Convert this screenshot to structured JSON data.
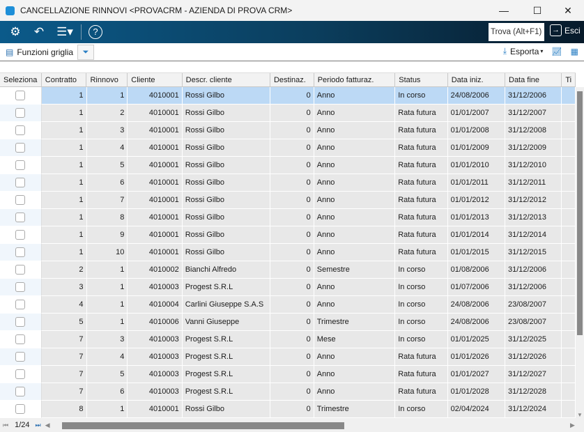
{
  "window": {
    "title": "CANCELLAZIONE RINNOVI <PROVACRM - AZIENDA DI PROVA CRM>",
    "minimize": "—",
    "maximize": "☐",
    "close": "✕"
  },
  "toolbar": {
    "find_label": "Trova (Alt+F1)",
    "exit_label": "Esci"
  },
  "gridbar": {
    "functions_label": "Funzioni griglia",
    "export_label": "Esporta"
  },
  "columns": [
    "Seleziona",
    "Contratto",
    "Rinnovo",
    "Cliente",
    "Descr. cliente",
    "Destinaz.",
    "Periodo fatturaz.",
    "Status",
    "Data iniz.",
    "Data fine",
    "Ti"
  ],
  "rows": [
    [
      "1",
      "1",
      "4010001",
      "Rossi Gilbo",
      "0",
      "Anno",
      "In corso",
      "24/08/2006",
      "31/12/2006"
    ],
    [
      "1",
      "2",
      "4010001",
      "Rossi Gilbo",
      "0",
      "Anno",
      "Rata futura",
      "01/01/2007",
      "31/12/2007"
    ],
    [
      "1",
      "3",
      "4010001",
      "Rossi Gilbo",
      "0",
      "Anno",
      "Rata futura",
      "01/01/2008",
      "31/12/2008"
    ],
    [
      "1",
      "4",
      "4010001",
      "Rossi Gilbo",
      "0",
      "Anno",
      "Rata futura",
      "01/01/2009",
      "31/12/2009"
    ],
    [
      "1",
      "5",
      "4010001",
      "Rossi Gilbo",
      "0",
      "Anno",
      "Rata futura",
      "01/01/2010",
      "31/12/2010"
    ],
    [
      "1",
      "6",
      "4010001",
      "Rossi Gilbo",
      "0",
      "Anno",
      "Rata futura",
      "01/01/2011",
      "31/12/2011"
    ],
    [
      "1",
      "7",
      "4010001",
      "Rossi Gilbo",
      "0",
      "Anno",
      "Rata futura",
      "01/01/2012",
      "31/12/2012"
    ],
    [
      "1",
      "8",
      "4010001",
      "Rossi Gilbo",
      "0",
      "Anno",
      "Rata futura",
      "01/01/2013",
      "31/12/2013"
    ],
    [
      "1",
      "9",
      "4010001",
      "Rossi Gilbo",
      "0",
      "Anno",
      "Rata futura",
      "01/01/2014",
      "31/12/2014"
    ],
    [
      "1",
      "10",
      "4010001",
      "Rossi Gilbo",
      "0",
      "Anno",
      "Rata futura",
      "01/01/2015",
      "31/12/2015"
    ],
    [
      "2",
      "1",
      "4010002",
      "Bianchi Alfredo",
      "0",
      "Semestre",
      "In corso",
      "01/08/2006",
      "31/12/2006"
    ],
    [
      "3",
      "1",
      "4010003",
      "Progest S.R.L",
      "0",
      "Anno",
      "In corso",
      "01/07/2006",
      "31/12/2006"
    ],
    [
      "4",
      "1",
      "4010004",
      "Carlini Giuseppe S.A.S",
      "0",
      "Anno",
      "In corso",
      "24/08/2006",
      "23/08/2007"
    ],
    [
      "5",
      "1",
      "4010006",
      "Vanni Giuseppe",
      "0",
      "Trimestre",
      "In corso",
      "24/08/2006",
      "23/08/2007"
    ],
    [
      "7",
      "3",
      "4010003",
      "Progest S.R.L",
      "0",
      "Mese",
      "In corso",
      "01/01/2025",
      "31/12/2025"
    ],
    [
      "7",
      "4",
      "4010003",
      "Progest S.R.L",
      "0",
      "Anno",
      "Rata futura",
      "01/01/2026",
      "31/12/2026"
    ],
    [
      "7",
      "5",
      "4010003",
      "Progest S.R.L",
      "0",
      "Anno",
      "Rata futura",
      "01/01/2027",
      "31/12/2027"
    ],
    [
      "7",
      "6",
      "4010003",
      "Progest S.R.L",
      "0",
      "Anno",
      "Rata futura",
      "01/01/2028",
      "31/12/2028"
    ],
    [
      "8",
      "1",
      "4010001",
      "Rossi Gilbo",
      "0",
      "Trimestre",
      "In corso",
      "02/04/2024",
      "31/12/2024"
    ]
  ],
  "pager": {
    "page": "1/24"
  }
}
